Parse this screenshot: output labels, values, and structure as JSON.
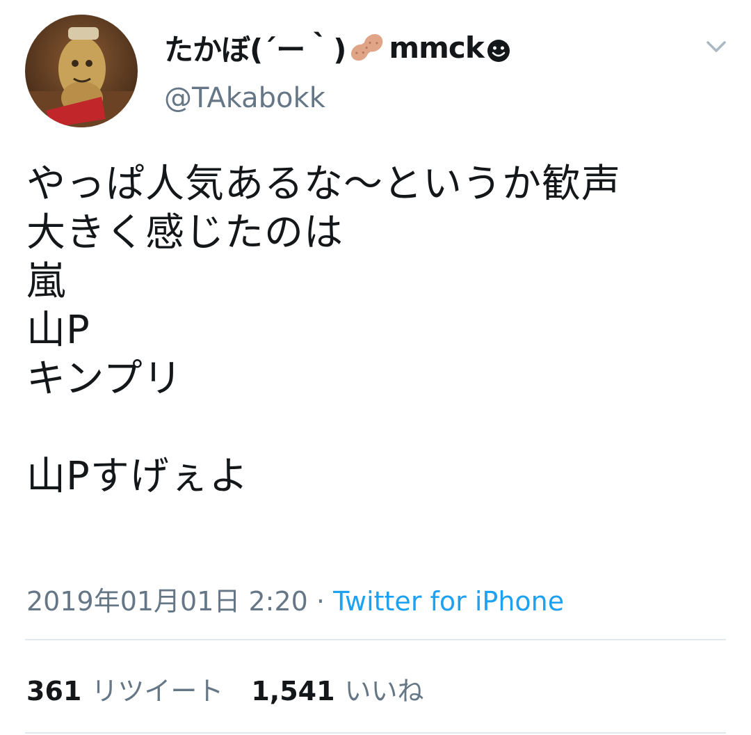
{
  "tweet": {
    "display_name": "たかぼ(´ー｀)",
    "display_name_suffix": "mmck",
    "name_emoji": [
      "peanut-icon",
      "smiley-icon"
    ],
    "handle": "@TAkabokk",
    "text": "やっぱ人気あるな〜というか歓声\n大きく感じたのは\n嵐\n山P\nキンプリ\n\n山Pすげぇよ",
    "timestamp": "2019年01月01日 2:20",
    "separator": " · ",
    "source": "Twitter for iPhone",
    "retweets_count": "361",
    "retweets_label": "リツイート",
    "likes_count": "1,541",
    "likes_label": "いいね"
  },
  "colors": {
    "text": "#14171a",
    "secondary": "#657786",
    "link": "#1da1f2",
    "divider": "#e1e8ed"
  }
}
